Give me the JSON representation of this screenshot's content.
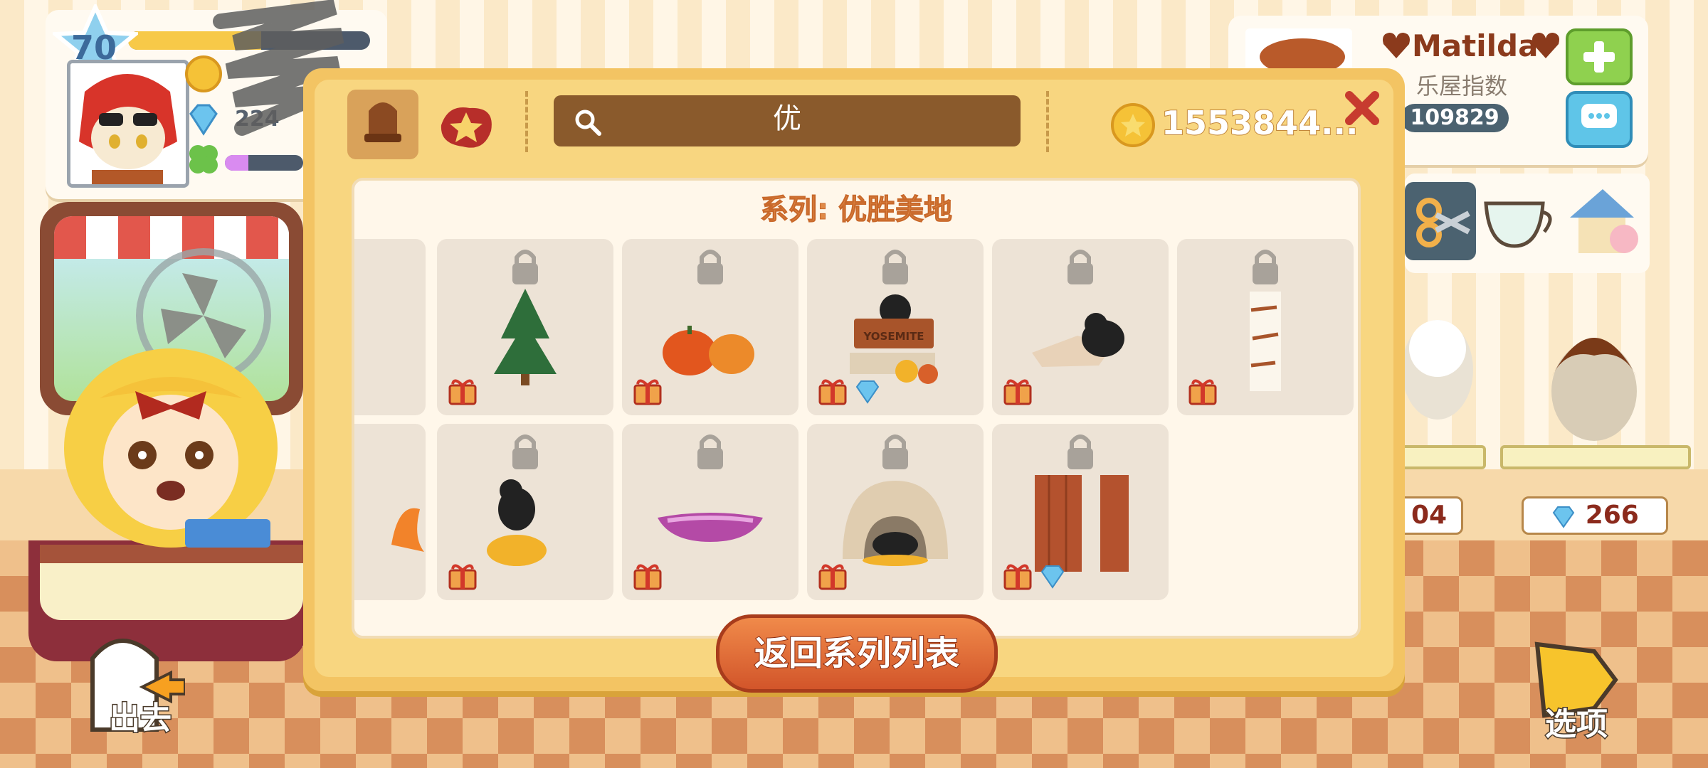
{
  "player": {
    "level": "70",
    "xp_progress": 0.55,
    "gem_value_partial": "224",
    "clover_progress": 0.3
  },
  "profile": {
    "name": "Matilda",
    "house_index_label": "乐屋指数",
    "house_index_value": "109829"
  },
  "catalog": {
    "search_value": "优",
    "coins": "1553844...",
    "series_title": "系列: 优胜美地",
    "back_button": "返回系列列表",
    "items": [
      {
        "row": 0,
        "col": 0,
        "locked": true,
        "gift": false,
        "gem": false,
        "icon": "partial-item-icon"
      },
      {
        "row": 0,
        "col": 1,
        "locked": true,
        "gift": true,
        "gem": false,
        "icon": "pine-tree-icon"
      },
      {
        "row": 0,
        "col": 2,
        "locked": true,
        "gift": true,
        "gem": false,
        "icon": "pumpkins-icon"
      },
      {
        "row": 0,
        "col": 3,
        "locked": true,
        "gift": true,
        "gem": true,
        "icon": "yosemite-sign-bear-icon",
        "label": "YOSEMITE"
      },
      {
        "row": 0,
        "col": 4,
        "locked": true,
        "gift": true,
        "gem": false,
        "icon": "bear-on-rock-icon"
      },
      {
        "row": 0,
        "col": 5,
        "locked": true,
        "gift": true,
        "gem": false,
        "icon": "birch-trunk-icon"
      },
      {
        "row": 1,
        "col": 0,
        "locked": true,
        "gift": false,
        "gem": false,
        "icon": "campfire-icon"
      },
      {
        "row": 1,
        "col": 1,
        "locked": true,
        "gift": true,
        "gem": false,
        "icon": "bear-leaves-icon"
      },
      {
        "row": 1,
        "col": 2,
        "locked": true,
        "gift": true,
        "gem": false,
        "icon": "canoe-icon"
      },
      {
        "row": 1,
        "col": 3,
        "locked": true,
        "gift": true,
        "gem": false,
        "icon": "bear-cave-icon"
      },
      {
        "row": 1,
        "col": 4,
        "locked": true,
        "gift": true,
        "gem": true,
        "icon": "wood-pillars-icon"
      }
    ]
  },
  "prices": {
    "left_partial": "04",
    "right": "266"
  },
  "buttons": {
    "go_out": "出去",
    "options": "选项"
  },
  "colors": {
    "dialog": "#f3c463",
    "search_bar": "#8a5a2c",
    "back_button": "#e0672f",
    "accent_green": "#8fd14f",
    "accent_blue": "#5fc5e8"
  }
}
